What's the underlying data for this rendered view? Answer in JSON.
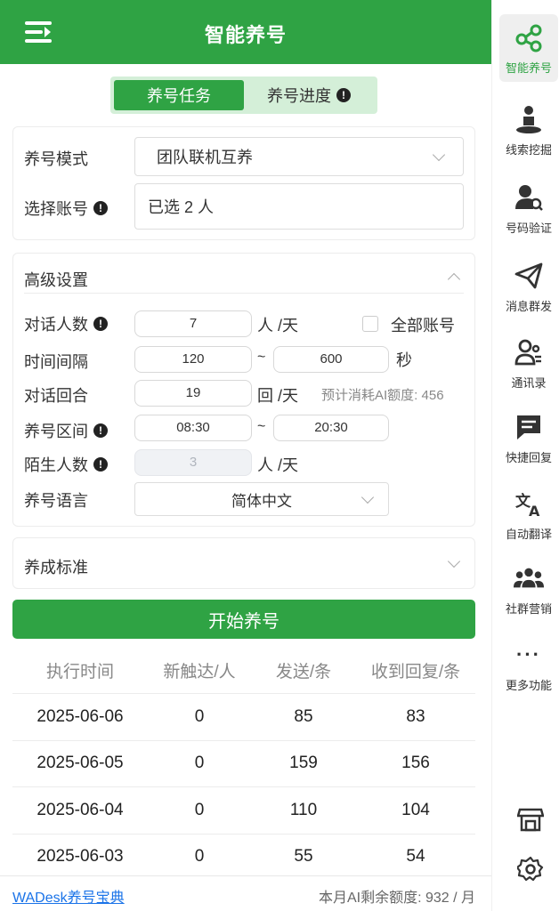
{
  "header": {
    "title": "智能养号"
  },
  "tabs": [
    {
      "label": "养号任务",
      "active": true
    },
    {
      "label": "养号进度",
      "active": false
    }
  ],
  "mode": {
    "label": "养号模式",
    "value": "团队联机互养"
  },
  "account": {
    "label": "选择账号",
    "value": "已选 2 人"
  },
  "advanced": {
    "title": "高级设置",
    "dialogs": {
      "label": "对话人数",
      "value": "7",
      "unit": "人 /天",
      "all_label": "全部账号"
    },
    "interval": {
      "label": "时间间隔",
      "from": "120",
      "sep": "~",
      "to": "600",
      "unit": "秒"
    },
    "rounds": {
      "label": "对话回合",
      "value": "19",
      "unit": "回 /天",
      "hint": "预计消耗AI额度: 456"
    },
    "range": {
      "label": "养号区间",
      "from": "08:30",
      "sep": "~",
      "to": "20:30"
    },
    "strangers": {
      "label": "陌生人数",
      "value": "3",
      "unit": "人 /天"
    },
    "language": {
      "label": "养号语言",
      "value": "简体中文"
    }
  },
  "standard": {
    "label": "养成标准"
  },
  "start_button": "开始养号",
  "table": {
    "headers": [
      "执行时间",
      "新触达/人",
      "发送/条",
      "收到回复/条"
    ],
    "rows": [
      [
        "2025-06-06",
        "0",
        "85",
        "83"
      ],
      [
        "2025-06-05",
        "0",
        "159",
        "156"
      ],
      [
        "2025-06-04",
        "0",
        "110",
        "104"
      ],
      [
        "2025-06-03",
        "0",
        "55",
        "54"
      ]
    ]
  },
  "footer": {
    "link": "WADesk养号宝典",
    "quota": "本月AI剩余额度: 932 / 月"
  },
  "sidebar": [
    {
      "label": "智能养号",
      "icon": "share-nodes-icon",
      "active": true
    },
    {
      "label": "线索挖掘",
      "icon": "person-dig-icon"
    },
    {
      "label": "号码验证",
      "icon": "user-search-icon"
    },
    {
      "label": "消息群发",
      "icon": "paper-plane-icon"
    },
    {
      "label": "通讯录",
      "icon": "contacts-icon"
    },
    {
      "label": "快捷回复",
      "icon": "message-icon"
    },
    {
      "label": "自动翻译",
      "icon": "translate-icon"
    },
    {
      "label": "社群营销",
      "icon": "group-icon"
    },
    {
      "label": "更多功能",
      "icon": "more-icon"
    }
  ],
  "colors": {
    "brand": "#2fa344",
    "tab_bg": "#d4efd8"
  }
}
